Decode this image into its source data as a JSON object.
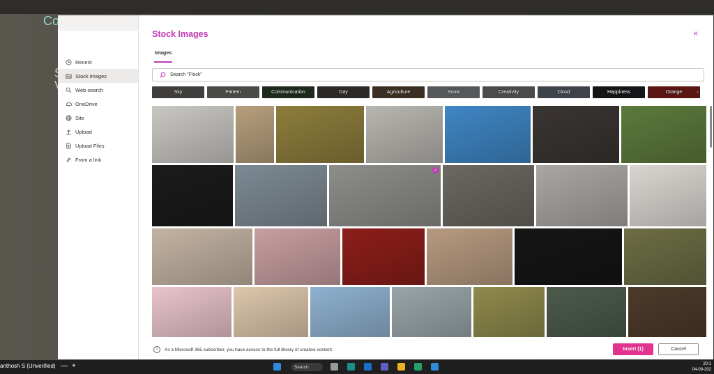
{
  "dialog": {
    "title": "Stock Images",
    "close_label": "×",
    "tab_label": "Images",
    "search_value": "Search \"Flock\"",
    "footer_note": "As a Microsoft 365 subscriber, you have access to the full library of creative content.",
    "insert_label": "Insert (1)",
    "cancel_label": "Cancel"
  },
  "sidebar": {
    "items": [
      {
        "label": "Recent",
        "icon": "clock-icon"
      },
      {
        "label": "Stock images",
        "icon": "image-icon",
        "active": true
      },
      {
        "label": "Web search",
        "icon": "search-icon"
      },
      {
        "label": "OneDrive",
        "icon": "cloud-icon"
      },
      {
        "label": "Site",
        "icon": "globe-icon"
      },
      {
        "label": "Upload",
        "icon": "upload-icon"
      },
      {
        "label": "Upload Files",
        "icon": "upload-files-icon"
      },
      {
        "label": "From a link",
        "icon": "link-icon"
      }
    ]
  },
  "categories": [
    {
      "label": "Sky",
      "color": "#3f3e3c"
    },
    {
      "label": "Pattern",
      "color": "#4a4a48"
    },
    {
      "label": "Communication",
      "color": "#1e2a1c"
    },
    {
      "label": "Day",
      "color": "#2c2a26"
    },
    {
      "label": "Agriculture",
      "color": "#3b2e22"
    },
    {
      "label": "Snow",
      "color": "#55575a"
    },
    {
      "label": "Creativity",
      "color": "#4b4b4b"
    },
    {
      "label": "Cloud",
      "color": "#3f434a"
    },
    {
      "label": "Happiness",
      "color": "#151518"
    },
    {
      "label": "Orange",
      "color": "#5a1612"
    }
  ],
  "images": [
    {
      "name": "medical-team-image",
      "color": "#c9c7c2",
      "selected": false
    },
    {
      "name": "hillside-town-image",
      "color": "#b79f7d",
      "selected": false
    },
    {
      "name": "autumn-lake-image",
      "color": "#8d7d3c",
      "selected": false
    },
    {
      "name": "memorial-guard-image",
      "color": "#b8b6b0",
      "selected": false
    },
    {
      "name": "skyscraper-image",
      "color": "#3f86c4",
      "selected": false
    },
    {
      "name": "suit-hands-image",
      "color": "#3a3532",
      "selected": false
    },
    {
      "name": "frangipani-flower-image",
      "color": "#5c7a3c",
      "selected": false
    },
    {
      "name": "ballet-dancers-image",
      "color": "#1b1b1b",
      "selected": false
    },
    {
      "name": "yoga-mat-image",
      "color": "#7d8a93",
      "selected": false
    },
    {
      "name": "spiral-staircase-image",
      "color": "#8d8d8b",
      "selected": true
    },
    {
      "name": "businesswoman-street-image",
      "color": "#6b6761",
      "selected": false
    },
    {
      "name": "kitchen-cooking-image",
      "color": "#a9a7a2",
      "selected": false
    },
    {
      "name": "cosmetics-lipsticks-image",
      "color": "#d9d6d1",
      "selected": false
    },
    {
      "name": "sleeping-woman-image",
      "color": "#c3b3a2",
      "selected": false
    },
    {
      "name": "tower-sunset-image",
      "color": "#c79ea1",
      "selected": false
    },
    {
      "name": "cinema-seats-image",
      "color": "#8c1e1a",
      "selected": false
    },
    {
      "name": "mother-child-image",
      "color": "#b79a80",
      "selected": false
    },
    {
      "name": "tiara-image",
      "color": "#151515",
      "selected": false
    },
    {
      "name": "olive-branch-image",
      "color": "#6c6d45",
      "selected": false
    },
    {
      "name": "pink-sprinkles-image",
      "color": "#e8c3cb",
      "selected": false
    },
    {
      "name": "illustration-people-image",
      "color": "#ddc7ac",
      "selected": false
    },
    {
      "name": "golden-gate-bridge-image",
      "color": "#8fb1cf",
      "selected": false
    },
    {
      "name": "woman-boat-image",
      "color": "#9aa5a9",
      "selected": false
    },
    {
      "name": "cat-heart-image",
      "color": "#8f8a4c",
      "selected": false
    },
    {
      "name": "city-bokeh-image",
      "color": "#4c5a4c",
      "selected": false
    },
    {
      "name": "pastry-bites-image",
      "color": "#4d3a2a",
      "selected": false
    }
  ],
  "taskbar": {
    "user": "anthosh S (Unverified)",
    "minus": "—",
    "plus": "+",
    "search_label": "Search",
    "time": "20:1",
    "date": "04-09-202"
  },
  "background": {
    "text_a": "Co",
    "text_b": "S",
    "text_c": "V"
  }
}
